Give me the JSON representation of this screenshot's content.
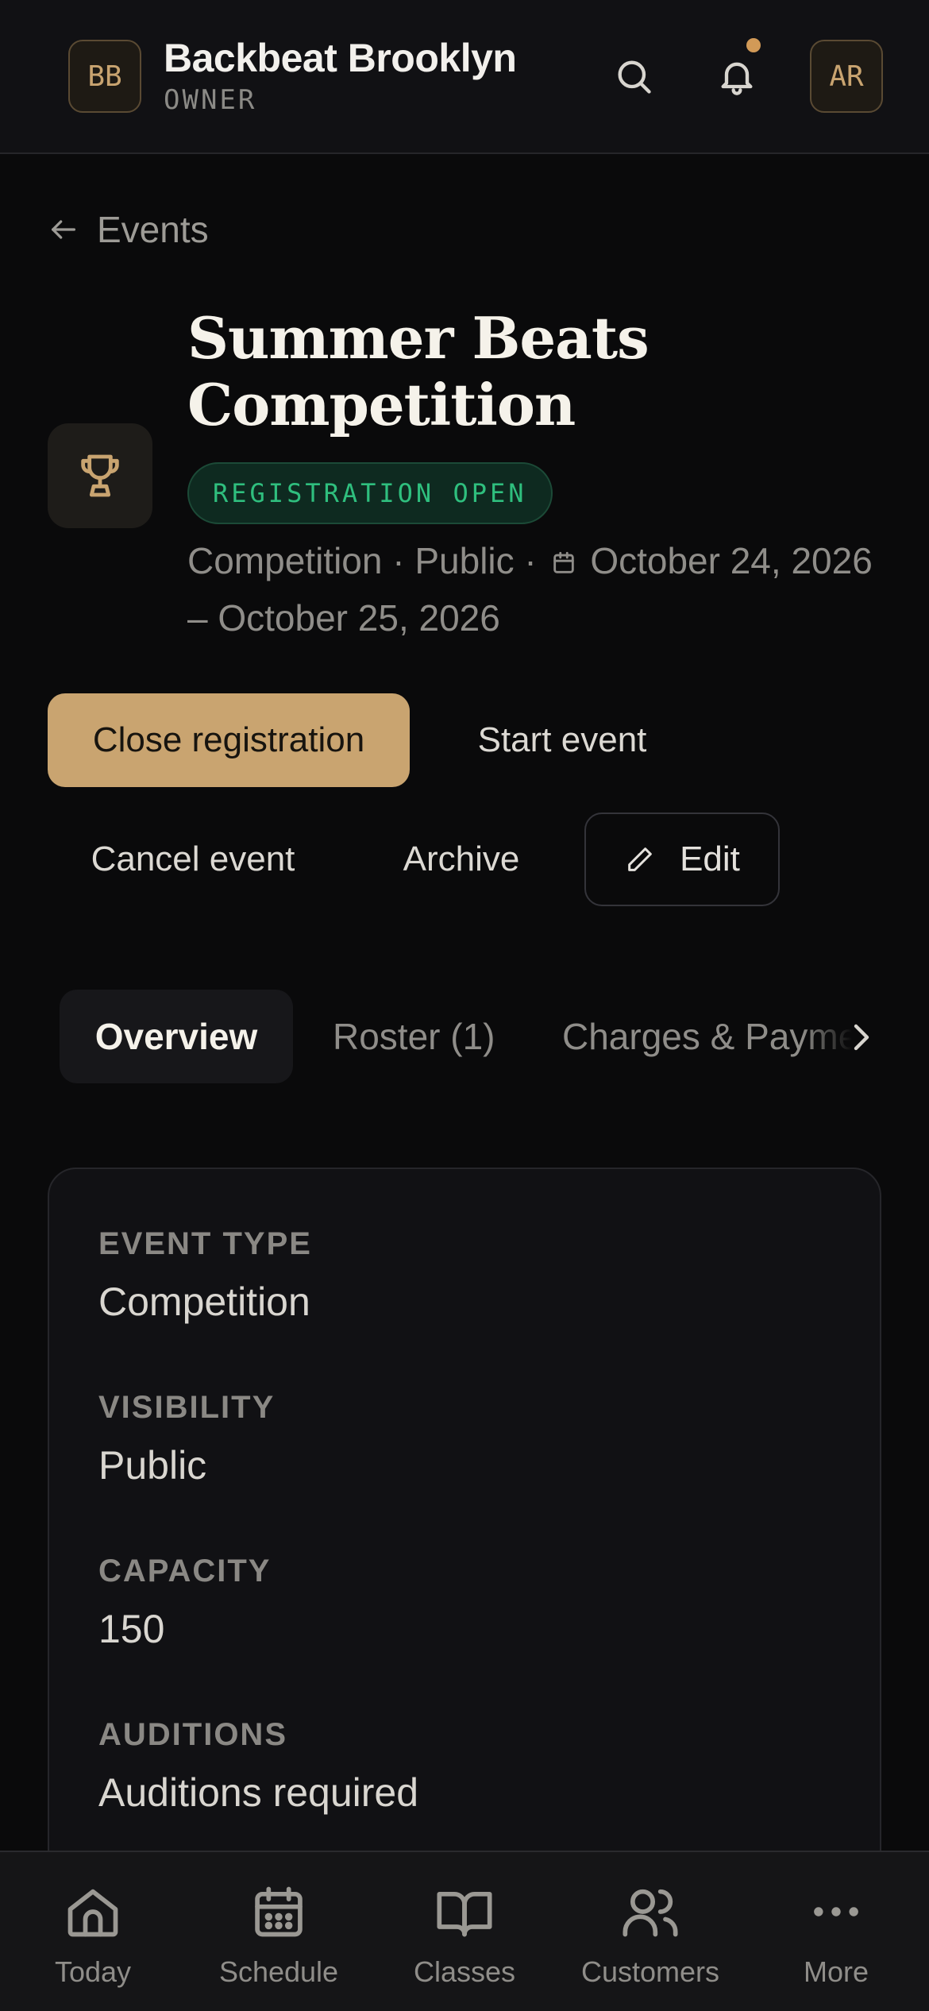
{
  "header": {
    "org_initials": "BB",
    "org_name": "Backbeat Brooklyn",
    "role": "OWNER",
    "user_initials": "AR",
    "icons": [
      "search-icon",
      "bell-icon"
    ],
    "notification_dot_color": "#d29a57"
  },
  "breadcrumb": {
    "label": "Events"
  },
  "event": {
    "icon": "trophy-icon",
    "title": "Summer Beats Competition",
    "status": "REGISTRATION OPEN",
    "type": "Competition",
    "visibility": "Public",
    "dates": "October 24, 2026 – October 25, 2026"
  },
  "actions": {
    "close_registration": "Close registration",
    "start_event": "Start event",
    "cancel_event": "Cancel event",
    "archive": "Archive",
    "edit": "Edit"
  },
  "tabs": [
    {
      "label": "Overview",
      "active": true
    },
    {
      "label": "Roster (1)",
      "active": false
    },
    {
      "label": "Charges & Payments",
      "active": false
    }
  ],
  "overview": {
    "fields": [
      {
        "label": "EVENT TYPE",
        "value": "Competition"
      },
      {
        "label": "VISIBILITY",
        "value": "Public"
      },
      {
        "label": "CAPACITY",
        "value": "150"
      },
      {
        "label": "AUDITIONS",
        "value": "Auditions required"
      }
    ]
  },
  "bottom_nav": [
    {
      "label": "Today",
      "icon": "home-icon"
    },
    {
      "label": "Schedule",
      "icon": "calendar-icon"
    },
    {
      "label": "Classes",
      "icon": "book-icon"
    },
    {
      "label": "Customers",
      "icon": "users-icon"
    },
    {
      "label": "More",
      "icon": "more-icon"
    }
  ],
  "colors": {
    "accent": "#c9a470",
    "background": "#0a0a0b",
    "success": "#2fbf7e"
  }
}
